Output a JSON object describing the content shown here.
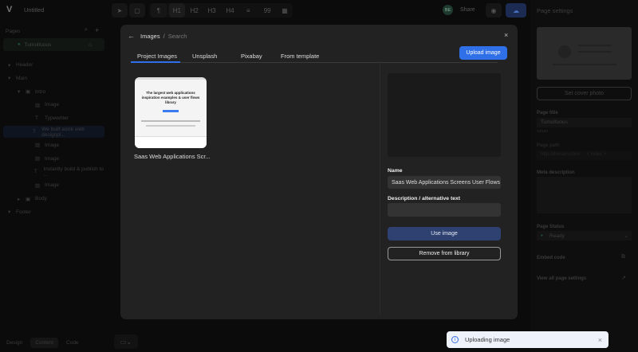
{
  "app": {
    "logo": "V",
    "title": "Untitled"
  },
  "toolbar": {
    "items": [
      "¶",
      "H1",
      "H2",
      "H3",
      "H4",
      "≡",
      "99",
      "▦"
    ],
    "avatar": "BE",
    "share": "Share"
  },
  "sidebar": {
    "pages_label": "Pages",
    "page": "Tumultuous",
    "tree": [
      {
        "label": "Header",
        "indent": 0,
        "arrow": "▾"
      },
      {
        "label": "Main",
        "indent": 0,
        "arrow": "▾"
      },
      {
        "label": "Intro",
        "indent": 1,
        "arrow": "▾",
        "icon": "▣"
      },
      {
        "label": "Image",
        "indent": 2,
        "icon": "▨"
      },
      {
        "label": "Typewriter",
        "indent": 2,
        "icon": "T"
      },
      {
        "label": "We built asick web designpl...",
        "indent": 2,
        "icon": "T"
      },
      {
        "label": "Image",
        "indent": 2,
        "icon": "▨"
      },
      {
        "label": "Image",
        "indent": 2,
        "icon": "▨"
      },
      {
        "label": "Instantly build & publish to ...",
        "indent": 2,
        "icon": "T"
      },
      {
        "label": "Image",
        "indent": 2,
        "icon": "▨"
      },
      {
        "label": "Body",
        "indent": 1,
        "arrow": "▸",
        "icon": "▣"
      },
      {
        "label": "Footer",
        "indent": 0,
        "arrow": "▾"
      }
    ]
  },
  "bottom": {
    "design": "Design",
    "content": "Content",
    "code": "Code"
  },
  "modal": {
    "breadcrumb_root": "Images",
    "breadcrumb_sep": "/",
    "breadcrumb_current": "Search",
    "tabs": [
      "Project Images",
      "Unsplash",
      "Pixabay",
      "From template"
    ],
    "upload": "Upload image",
    "thumb_caption": "Saas Web Applications Scr...",
    "thumb_headline": "The largest web applications inspiration examples & user flows library",
    "name_label": "Name",
    "name_value": "Saas Web Applications Screens User Flows Library",
    "desc_label": "Description / alternative text",
    "desc_value": "",
    "use": "Use image",
    "remove": "Remove from library"
  },
  "settings": {
    "title": "Page settings",
    "cover": "Set cover photo",
    "page_title_label": "Page title",
    "page_title": "Tumultuous",
    "count": "10/160",
    "path_label": "Page path",
    "path": "http://domain.com/",
    "path_index": "< index >",
    "meta_label": "Meta description",
    "status_label": "Page Status",
    "status": "Ready",
    "embed": "Embed code",
    "view_all": "View all page settings"
  },
  "toast": {
    "text": "Uploading image"
  }
}
